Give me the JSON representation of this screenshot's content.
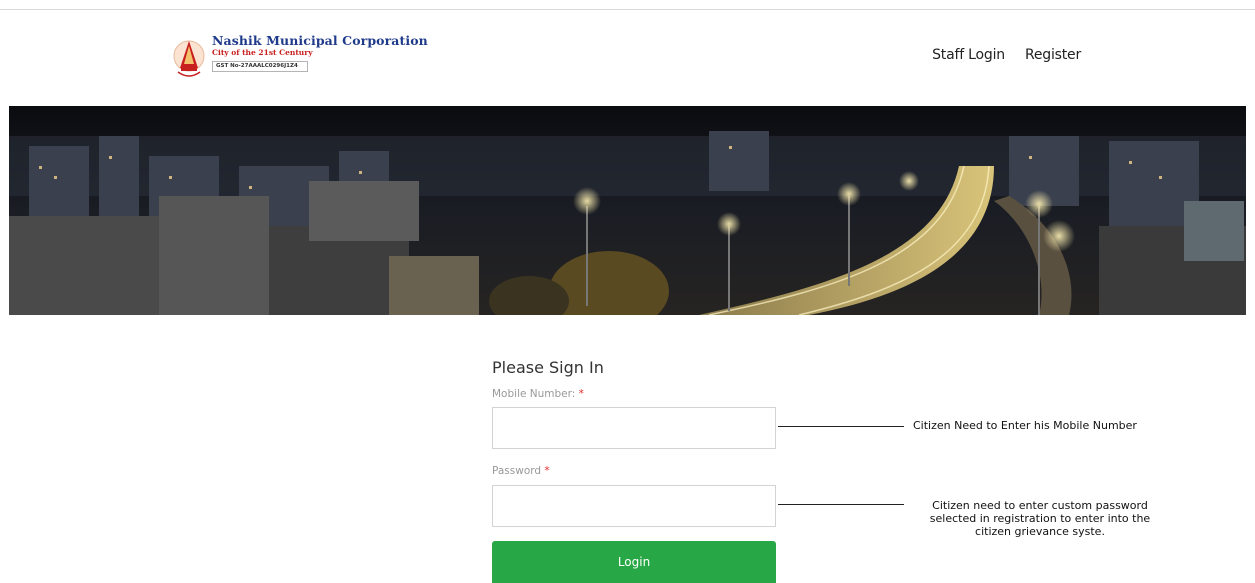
{
  "header": {
    "org_name": "Nashik Municipal Corporation",
    "tagline": "City of the 21st Century",
    "gst": "GST No-27AAALC0296J1Z4",
    "nav": {
      "staff_login": "Staff Login",
      "register": "Register"
    }
  },
  "signin": {
    "title": "Please Sign In",
    "mobile_label": "Mobile Number:",
    "password_label": "Password",
    "required_mark": "*",
    "mobile_value": "",
    "password_value": "",
    "login_label": "Login"
  },
  "annotations": {
    "mobile_note": "Citizen Need to Enter his Mobile Number",
    "password_note": "Citizen need to enter custom password selected in registration to enter into the citizen grievance syste."
  },
  "colors": {
    "login_button": "#27a745",
    "org_name": "#1f3a8a",
    "tagline": "#c8201f",
    "required": "#e03131"
  },
  "icons": {
    "logo": "nmc-emblem-icon"
  }
}
